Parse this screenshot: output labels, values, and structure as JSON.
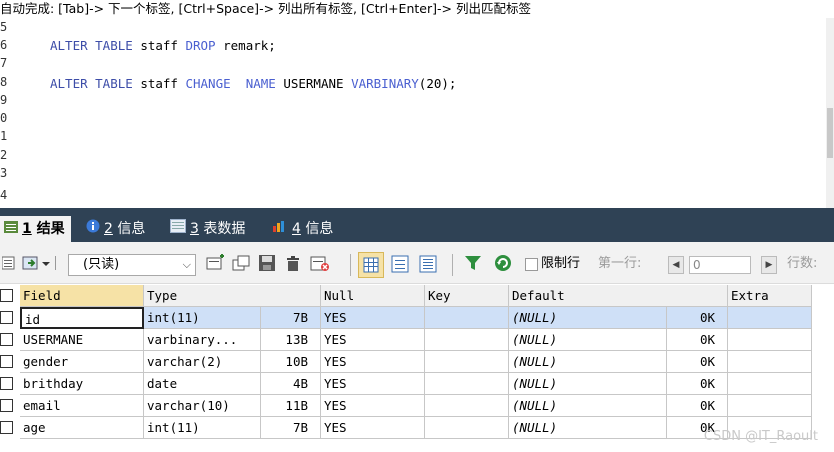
{
  "hint": "自动完成: [Tab]-> 下一个标签, [Ctrl+Space]-> 列出所有标签, [Ctrl+Enter]-> 列出匹配标签",
  "editor": {
    "line_numbers": [
      "5",
      "6",
      "7",
      "8",
      "9",
      "0",
      "1",
      "2",
      "3",
      "4"
    ],
    "lines": [
      {
        "kw1": "ALTER TABLE",
        "p1": " staff ",
        "kw2": "DROP",
        "p2": " remark;"
      },
      {
        "kw1": "ALTER TABLE",
        "p1": " staff ",
        "kw2": "CHANGE  NAME",
        "p2": " USERMANE ",
        "kw3": "VARBINARY",
        "p3": "(20);"
      }
    ]
  },
  "tabs": [
    {
      "num": "1",
      "label": " 结果"
    },
    {
      "num": "2",
      "label": " 信息"
    },
    {
      "num": "3",
      "label": " 表数据"
    },
    {
      "num": "4",
      "label": " 信息"
    }
  ],
  "toolbar": {
    "mode": "(只读)",
    "limit_label": "限制行",
    "first_row_label": "第一行:",
    "first_row_value": "0",
    "rows_label": "行数:"
  },
  "table": {
    "columns": [
      "Field",
      "Type",
      "Null",
      "Key",
      "Default",
      "Extra"
    ],
    "rows": [
      {
        "field": "id",
        "type": "int(11)",
        "size": "7B",
        "null": "YES",
        "key": "",
        "default": "(NULL)",
        "dsize": "0K",
        "extra": ""
      },
      {
        "field": "USERMANE",
        "type": "varbinary...",
        "size": "13B",
        "null": "YES",
        "key": "",
        "default": "(NULL)",
        "dsize": "0K",
        "extra": ""
      },
      {
        "field": "gender",
        "type": "varchar(2)",
        "size": "10B",
        "null": "YES",
        "key": "",
        "default": "(NULL)",
        "dsize": "0K",
        "extra": ""
      },
      {
        "field": "brithday",
        "type": "date",
        "size": "4B",
        "null": "YES",
        "key": "",
        "default": "(NULL)",
        "dsize": "0K",
        "extra": ""
      },
      {
        "field": "email",
        "type": "varchar(10)",
        "size": "11B",
        "null": "YES",
        "key": "",
        "default": "(NULL)",
        "dsize": "0K",
        "extra": ""
      },
      {
        "field": "age",
        "type": "int(11)",
        "size": "7B",
        "null": "YES",
        "key": "",
        "default": "(NULL)",
        "dsize": "0K",
        "extra": ""
      }
    ]
  },
  "watermark": "CSDN @IT_Raoult",
  "colors": {
    "tabs_bg": "#2f4255",
    "keyword": "#3d4da8",
    "selected_row": "#cfe0f7",
    "sorted_header": "#f6e2a6"
  }
}
